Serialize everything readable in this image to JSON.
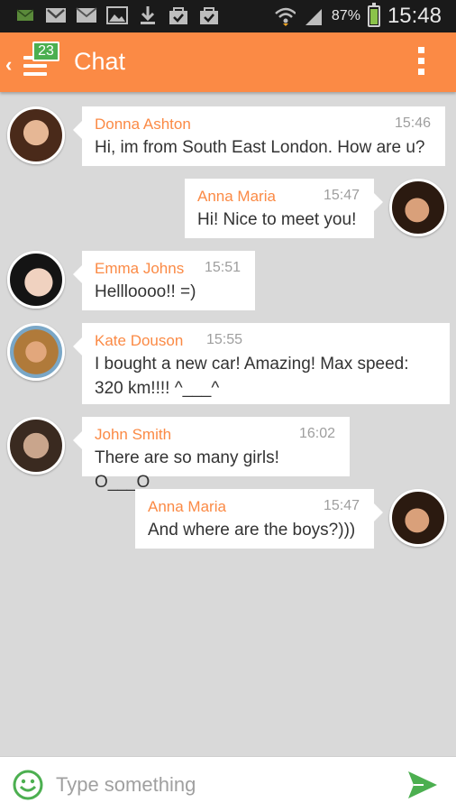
{
  "status_bar": {
    "battery": "87%",
    "battery_level": 0.87,
    "time": "15:48",
    "icons": [
      "sms-icon",
      "gmail-icon",
      "email-icon",
      "gallery-icon",
      "download-icon",
      "shopping-bag-check-icon",
      "shopping-bag-check-icon",
      "wifi-icon",
      "signal-icon",
      "battery-icon"
    ]
  },
  "app_bar": {
    "title": "Chat",
    "badge_count": "23",
    "menu": "overflow-menu-icon"
  },
  "messages": [
    {
      "sender": "Donna Ashton",
      "time": "15:46",
      "text": "Hi, im from South East London. How are u?",
      "side": "left"
    },
    {
      "sender": "Anna Maria",
      "time": "15:47",
      "text": "Hi! Nice to meet you!",
      "side": "right"
    },
    {
      "sender": "Emma Johns",
      "time": "15:51",
      "text": "Hellloooo!! =)",
      "side": "left"
    },
    {
      "sender": "Kate Douson",
      "time": "15:55",
      "text": "I bought a new car! Amazing! Max speed: 320 km!!!! ^___^",
      "side": "left"
    },
    {
      "sender": "John Smith",
      "time": "16:02",
      "text": "There are so many girls! O___O",
      "side": "left"
    },
    {
      "sender": "Anna Maria",
      "time": "15:47",
      "text": "And where are the boys?)))",
      "side": "right"
    }
  ],
  "input": {
    "placeholder": "Type something"
  },
  "colors": {
    "accent": "#fb8a45",
    "badge": "#4caf50",
    "send": "#4caf50",
    "background": "#d9d9d9"
  }
}
